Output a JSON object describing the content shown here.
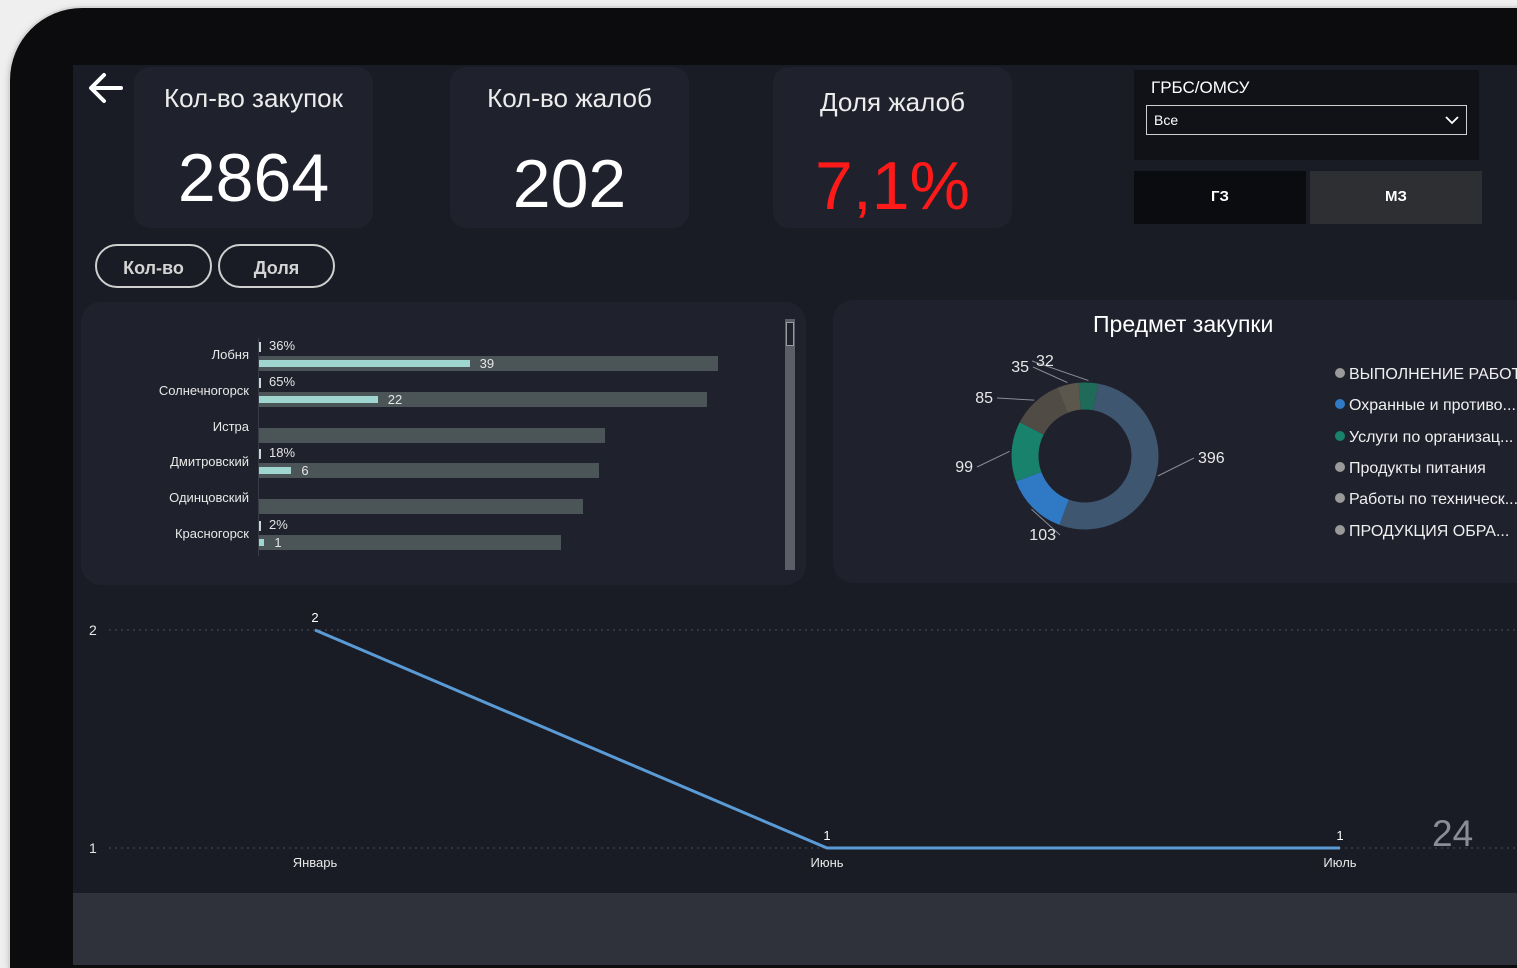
{
  "kpis": [
    {
      "title": "Кол-во закупок",
      "value": "2864",
      "color": "#ffffff"
    },
    {
      "title": "Кол-во жалоб",
      "value": "202",
      "color": "#ffffff"
    },
    {
      "title": "Доля жалоб",
      "value": "7,1%",
      "color": "#ff1a1a"
    }
  ],
  "filter": {
    "label": "ГРБС/ОМСУ",
    "selected": "Все"
  },
  "tabs": [
    "ГЗ",
    "МЗ"
  ],
  "toggles": [
    "Кол-во",
    "Доля"
  ],
  "bar_chart": {
    "categories": [
      "Лобня",
      "Солнечногорск",
      "Истра",
      "Дмитровский",
      "Одинцовский",
      "Красногорск"
    ],
    "totals": [
      85,
      83,
      64,
      63,
      60,
      56
    ],
    "values": [
      39,
      22,
      null,
      6,
      null,
      1
    ],
    "value_labels": [
      "39",
      "22",
      "",
      "6",
      "",
      "1"
    ],
    "shares": [
      "36%",
      "65%",
      "",
      "18%",
      "",
      "2%"
    ]
  },
  "donut": {
    "title": "Предмет закупки",
    "values": [
      396,
      103,
      99,
      85,
      35,
      32
    ],
    "labels": [
      "396",
      "103",
      "99",
      "85",
      "35",
      "32"
    ],
    "colors": [
      "#3f5670",
      "#2f79c5",
      "#18826c",
      "#504b45",
      "#5b574d",
      "#1f6a59"
    ],
    "legend": [
      "ВЫПОЛНЕНИЕ РАБОТ",
      "Охранные и противо...",
      "Услуги по организац...",
      "Продукты питания",
      "Работы по техническ...",
      "ПРОДУКЦИЯ ОБРА..."
    ],
    "legend_colors": [
      "#9a9a9a",
      "#2f79c5",
      "#18826c",
      "#9a9a9a",
      "#9a9a9a",
      "#9a9a9a"
    ]
  },
  "chart_data": {
    "type": "line",
    "categories": [
      "Январь",
      "Июнь",
      "Июль"
    ],
    "values": [
      2,
      1,
      1
    ],
    "value_labels": [
      "2",
      "1",
      "1"
    ],
    "y_ticks": [
      "1",
      "2"
    ],
    "ylim": [
      1,
      2
    ],
    "line_color": "#5b9bd5"
  },
  "page_number": "24"
}
